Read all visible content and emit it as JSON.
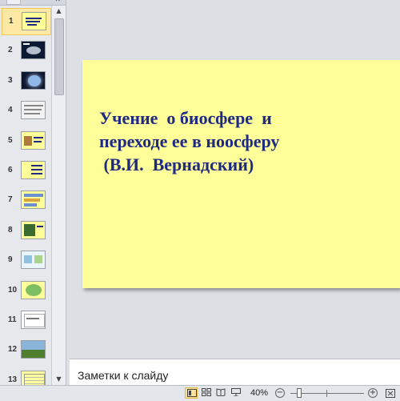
{
  "thumbnails": {
    "slides": [
      {
        "number": "1",
        "style": "title",
        "selected": true
      },
      {
        "number": "2",
        "style": "space-dark"
      },
      {
        "number": "3",
        "style": "space-glow"
      },
      {
        "number": "4",
        "style": "text-gray"
      },
      {
        "number": "5",
        "style": "yellow-image"
      },
      {
        "number": "6",
        "style": "yellow-list"
      },
      {
        "number": "7",
        "style": "yellow-diagram"
      },
      {
        "number": "8",
        "style": "yellow-photo"
      },
      {
        "number": "9",
        "style": "blue-diagram"
      },
      {
        "number": "10",
        "style": "green-image"
      },
      {
        "number": "11",
        "style": "text-box"
      },
      {
        "number": "12",
        "style": "landscape"
      },
      {
        "number": "13",
        "style": "table"
      }
    ],
    "scroll_up_glyph": "▲",
    "scroll_down_glyph": "▼",
    "close_glyph": "✕"
  },
  "slide": {
    "title": "Учение  о биосфере  и\nпереходе ее в ноосферу\n (В.И.  Вернадский)",
    "background_color": "#ffff99",
    "title_color": "#1f2a85"
  },
  "notes": {
    "placeholder": "Заметки к слайду"
  },
  "status_bar": {
    "zoom_level": "40%",
    "zoom_out_glyph": "−",
    "zoom_in_glyph": "+",
    "active_view": "normal"
  }
}
